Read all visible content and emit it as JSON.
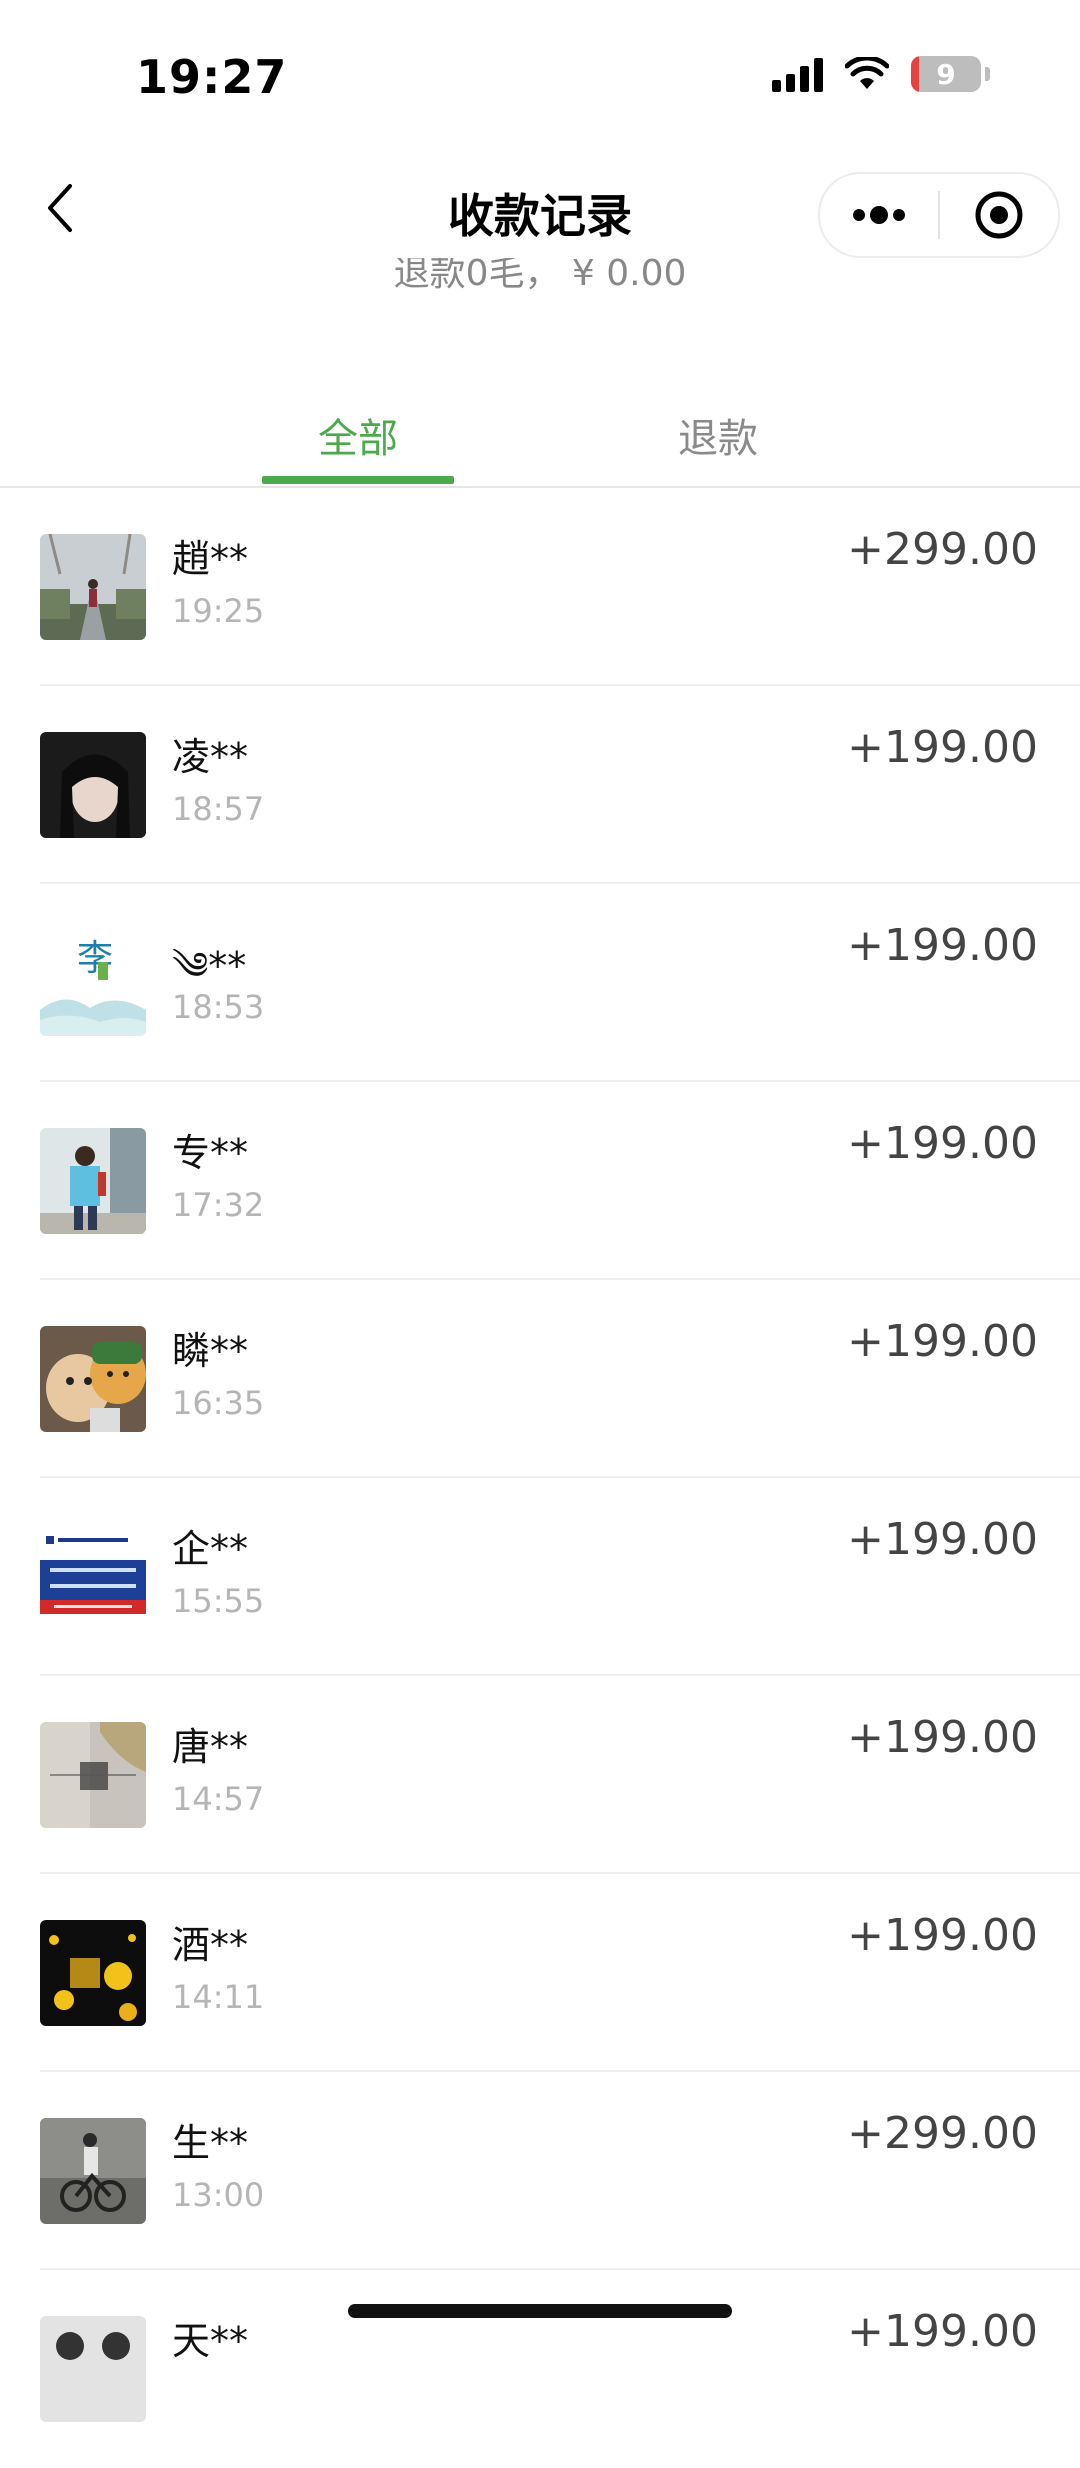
{
  "status_bar": {
    "time": "19:27",
    "battery": "9",
    "battery_level": 0.09
  },
  "nav": {
    "title": "收款记录"
  },
  "summary": {
    "text": "退款0毛， ¥ 0.00"
  },
  "tabs": [
    {
      "label": "全部",
      "active": true
    },
    {
      "label": "退款",
      "active": false
    }
  ],
  "colors": {
    "accent": "#4caa4a",
    "amount": "#444444",
    "time": "#b5b5b5"
  },
  "records": [
    {
      "name": "趙**",
      "time": "19:25",
      "amount": "+299.00"
    },
    {
      "name": "凌**",
      "time": "18:57",
      "amount": "+199.00"
    },
    {
      "name": "༄**",
      "time": "18:53",
      "amount": "+199.00"
    },
    {
      "name": "专**",
      "time": "17:32",
      "amount": "+199.00"
    },
    {
      "name": "瞵**",
      "time": "16:35",
      "amount": "+199.00"
    },
    {
      "name": "企**",
      "time": "15:55",
      "amount": "+199.00"
    },
    {
      "name": "唐**",
      "time": "14:57",
      "amount": "+199.00"
    },
    {
      "name": "酒**",
      "time": "14:11",
      "amount": "+199.00"
    },
    {
      "name": "生**",
      "time": "13:00",
      "amount": "+299.00"
    },
    {
      "name": "天**",
      "time": "",
      "amount": "+199.00"
    }
  ]
}
